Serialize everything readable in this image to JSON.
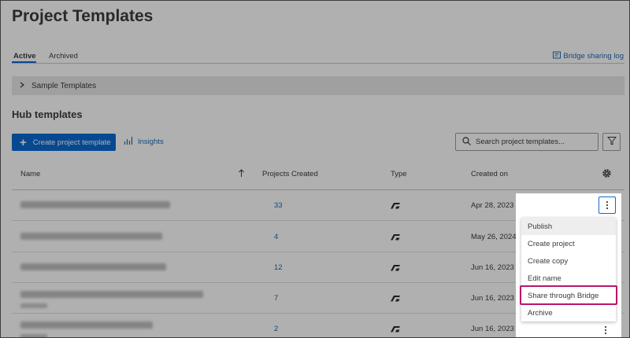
{
  "page": {
    "title": "Project Templates"
  },
  "tabs": [
    {
      "label": "Active",
      "active": true
    },
    {
      "label": "Archived",
      "active": false
    }
  ],
  "header_link": {
    "label": "Bridge sharing log",
    "icon": "bridge-log-icon"
  },
  "sample_section": {
    "label": "Sample Templates",
    "icon": "chevron-right-icon"
  },
  "hub_section": {
    "title": "Hub templates"
  },
  "toolbar": {
    "create_label": "Create project template",
    "create_icon": "plus-icon",
    "insights_label": "Insights",
    "insights_icon": "bar-chart-icon",
    "search_placeholder": "Search project templates...",
    "search_icon": "search-icon",
    "filter_icon": "filter-icon"
  },
  "table": {
    "columns": [
      "Name",
      "Projects Created",
      "Type",
      "Created on"
    ],
    "sort_icon": "sort-ascending-icon",
    "settings_icon": "gear-icon",
    "rows": [
      {
        "projects": "33",
        "type_icon": "acc-logo-icon",
        "created": "Apr 28, 2023"
      },
      {
        "projects": "4",
        "type_icon": "acc-logo-icon",
        "created": "May 26, 2024"
      },
      {
        "projects": "12",
        "type_icon": "acc-logo-icon",
        "created": "Jun 16, 2023"
      },
      {
        "projects": "7",
        "type_icon": "acc-logo-icon",
        "created": "Jun 16, 2023"
      },
      {
        "projects": "2",
        "type_icon": "acc-logo-icon",
        "created": "Jun 16, 2023"
      }
    ]
  },
  "context_menu": {
    "trigger_icon": "kebab-menu-icon",
    "items": [
      "Publish",
      "Create project",
      "Create copy",
      "Edit name",
      "Share through Bridge",
      "Archive"
    ],
    "highlighted_item": "Share through Bridge"
  },
  "colors": {
    "accent": "#0a6ad2",
    "link": "#1d6bb5",
    "highlight": "#b9166a",
    "overlay": "rgba(0,0,0,0.31)"
  }
}
